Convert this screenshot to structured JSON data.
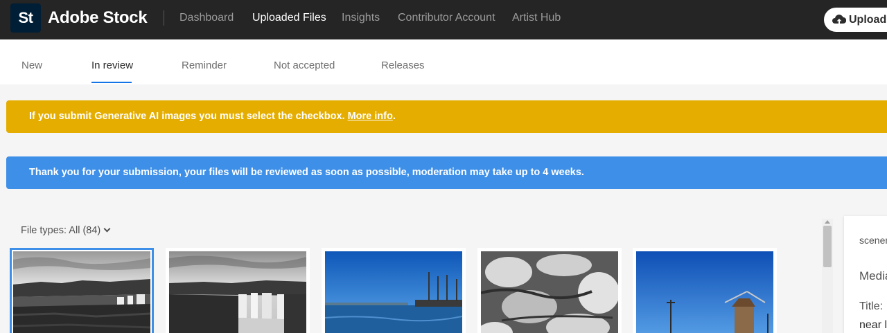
{
  "header": {
    "logo_text": "St",
    "brand": "Adobe Stock",
    "nav": [
      "Dashboard",
      "Uploaded Files",
      "Insights",
      "Contributor Account",
      "Artist Hub"
    ],
    "active_nav": "Uploaded Files",
    "upload_label": "Upload"
  },
  "tabs": {
    "items": [
      "New",
      "In review",
      "Reminder",
      "Not accepted",
      "Releases"
    ],
    "active": "In review",
    "accent": "#1473e6"
  },
  "banners": {
    "warning": {
      "text": "If you submit Generative AI images you must select the checkbox.",
      "link": "More info",
      "trailing": ".",
      "color": "#e4ad00"
    },
    "info": {
      "text": "Thank you for your submission, your files will be reviewed as soon as possible, moderation may take up to 4 weeks.",
      "color": "#3d8fe8"
    }
  },
  "filter": {
    "label": "File types: All (84)"
  },
  "thumbnails": [
    {
      "subject": "black and white waterfall over cliffs",
      "selected": true
    },
    {
      "subject": "black and white waterfall over cliffs",
      "selected": false
    },
    {
      "subject": "harbor with sailing ships under blue sky",
      "selected": false
    },
    {
      "subject": "black and white rock texture",
      "selected": false
    },
    {
      "subject": "wooden windmill under blue sky",
      "selected": false
    }
  ],
  "side_panel": {
    "line1": "scenery",
    "line2": "Media",
    "line3": "Title:",
    "line4": "near l"
  }
}
